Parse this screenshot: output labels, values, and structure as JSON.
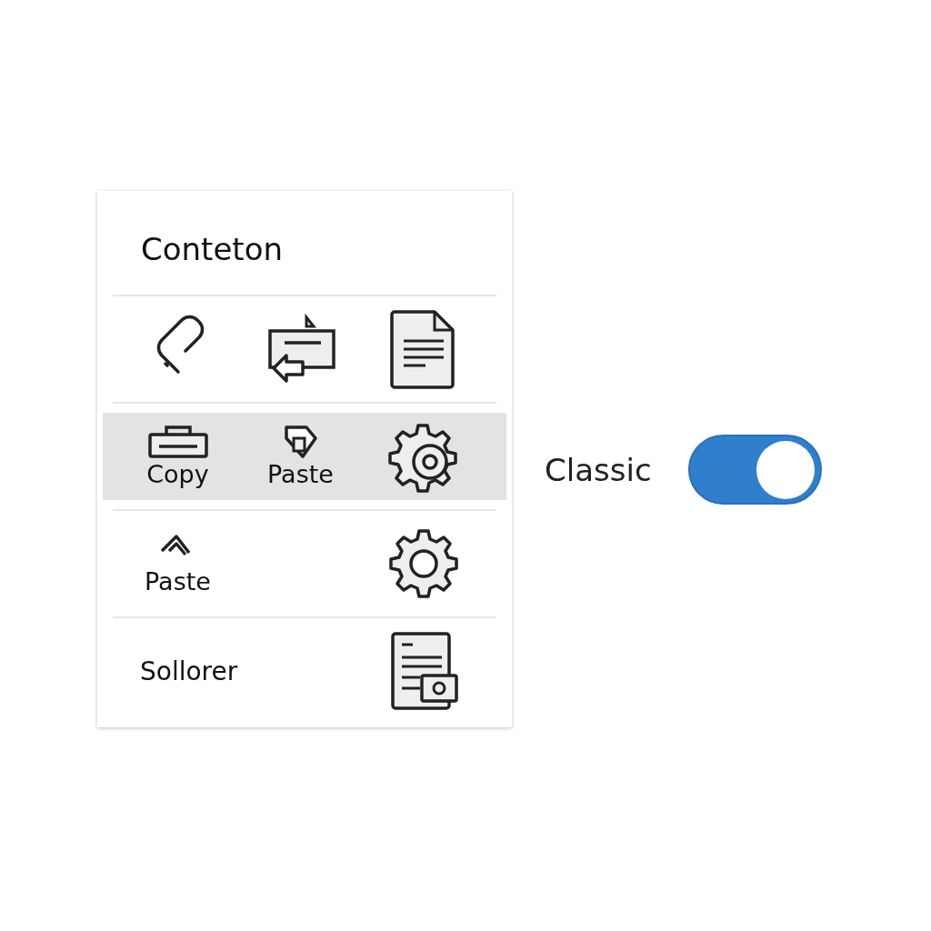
{
  "panel": {
    "title": "Conteton",
    "rows": [
      {
        "selected": false
      },
      {
        "selected": true,
        "labels": [
          "Copy",
          "Paste"
        ]
      },
      {
        "selected": false,
        "labels": [
          "Paste"
        ]
      },
      {
        "selected": false,
        "labels": [
          "Sollorer"
        ]
      }
    ]
  },
  "toggle": {
    "label": "Classic",
    "on": true
  }
}
